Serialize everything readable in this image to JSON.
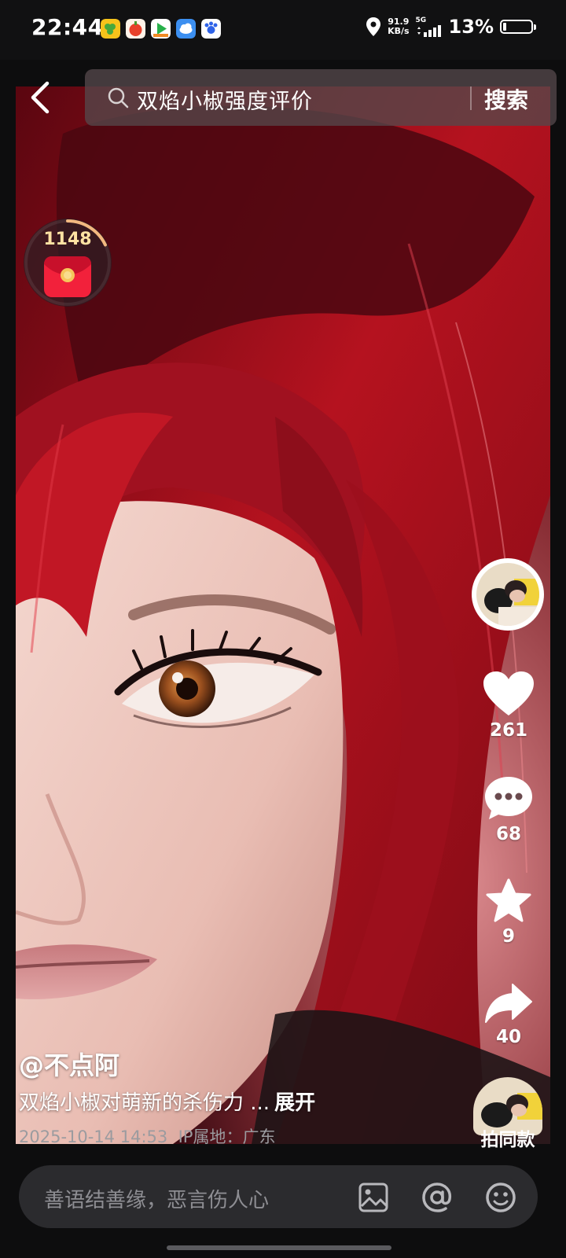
{
  "status_bar": {
    "time": "22:44",
    "net_speed_value": "91.9",
    "net_speed_unit": "KB/s",
    "network": "5G",
    "battery_percent": "13%",
    "battery_level": 0.13,
    "app_icons": [
      "grape-app-icon",
      "fruit-app-icon",
      "video-app-icon",
      "cloud-app-icon",
      "paw-app-icon"
    ]
  },
  "search": {
    "query": "双焰小椒强度评价",
    "button_label": "搜索"
  },
  "red_packet": {
    "count": "1148",
    "progress": 0.18
  },
  "actions": {
    "likes": "261",
    "comments": "68",
    "favorites": "9",
    "shares": "40",
    "same_style_label": "拍同款"
  },
  "post": {
    "author": "@不点阿",
    "description": "双焰小椒对萌新的杀伤力 ...",
    "expand_label": "展开",
    "date_time": "2025-10-14 14:53",
    "ip_location": "IP属地：广东"
  },
  "comment_bar": {
    "placeholder": "善语结善缘，恶言伤人心"
  },
  "colors": {
    "background": "#0d0d0e",
    "hair_red": "#b3121f",
    "search_bg": "#554849",
    "meta_gray": "#9b9b9f",
    "red_packet": "#e8223a",
    "count_gold": "#ffe2a3"
  }
}
